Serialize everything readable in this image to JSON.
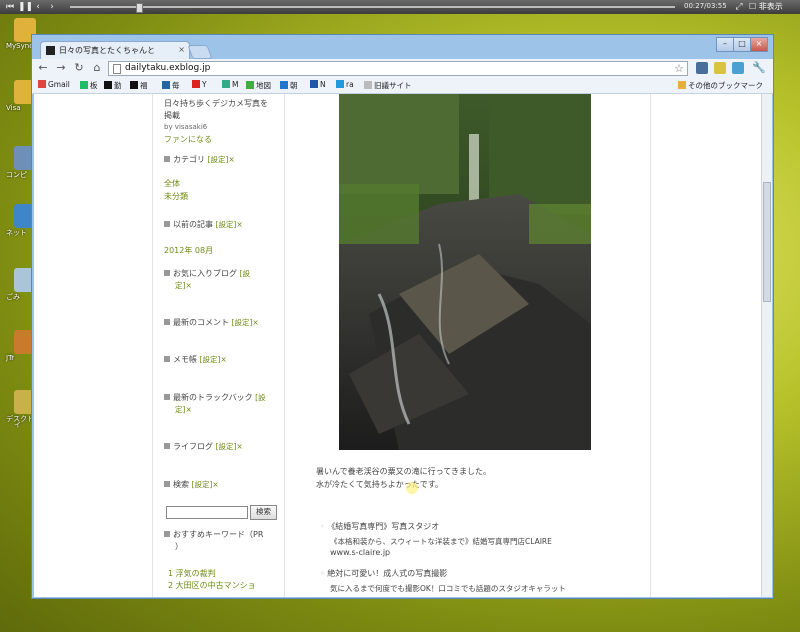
{
  "media_bar": {
    "time": "00:27/03:55",
    "toggle_label": "非表示"
  },
  "desktop": {
    "icons": [
      {
        "label": "MySync",
        "color": "#e0b23c"
      },
      {
        "label": "Visa",
        "color": "#e0b23c"
      },
      {
        "label": "コンピ",
        "color": "#6d8fb8"
      },
      {
        "label": "ネット",
        "color": "#3f86c8"
      },
      {
        "label": "ごみ",
        "color": "#aac4d8"
      },
      {
        "label": "JTr",
        "color": "#c87b2c"
      },
      {
        "label": "デスクト",
        "color": "#c9b04a"
      },
      {
        "label": "イ",
        "color": "#c9b04a"
      }
    ]
  },
  "browser": {
    "tab_title": "日々の写真とたくちゃんと",
    "url": "dailytaku.exblog.jp",
    "bookmarks": [
      {
        "label": "Gmail",
        "color": "#d44"
      },
      {
        "label": "板",
        "color": "#2b6"
      },
      {
        "label": "勤",
        "color": "#111"
      },
      {
        "label": "福",
        "color": "#111"
      },
      {
        "label": "毎",
        "color": "#26a"
      },
      {
        "label": "Y",
        "color": "#d22"
      },
      {
        "label": "M",
        "color": "#3a8"
      },
      {
        "label": "地図",
        "color": "#4a4"
      },
      {
        "label": "朝",
        "color": "#27c"
      },
      {
        "label": "N",
        "color": "#25a"
      },
      {
        "label": "ra",
        "color": "#29d"
      },
      {
        "label": "旧議サイト",
        "color": "#bbb"
      }
    ],
    "other_bookmarks": "その他のブックマーク"
  },
  "sidebar": {
    "profile_line1": "日々持ち歩くデジカメ写真を",
    "profile_line2": "掲載",
    "by_line": "by visasaki6",
    "fan_link": "ファンになる",
    "setting_label": "[設定]",
    "remove_label": "×",
    "categories_heading": "カテゴリ",
    "categories": [
      "全体",
      "未分類"
    ],
    "archive_heading": "以前の記事",
    "archive_items": [
      "2012年 08月"
    ],
    "favorites_heading_1": "お気に入りブログ",
    "favorites_cfg_1": "[設",
    "favorites_cfg_2": "定]",
    "recent_comments_heading": "最新のコメント",
    "memo_heading": "メモ帳",
    "trackback_heading": "最新のトラックバック",
    "trackback_cfg_1": "[設",
    "trackback_cfg_2": "定]",
    "lifelog_heading": "ライフログ",
    "search_heading": "検索",
    "search_button": "検索",
    "keywords_heading_1": "おすすめキーワード（PR",
    "keywords_heading_2": "）",
    "keywords": [
      "1 浮気の裁判",
      "2 大田区の中古マンショ"
    ]
  },
  "post": {
    "text_line1": "暑いんで養老渓谷の粟又の滝に行ってきました。",
    "text_line2": "水が冷たくて気持ちよかったです。",
    "ads": [
      {
        "title": "《結婚写真専門》写真スタジオ",
        "desc": "《本格和装から、スウィートな洋装まで》結婚写真専門店CLAIRE",
        "url": "www.s-claire.jp"
      },
      {
        "title": "絶対に可愛い！成人式の写真撮影",
        "desc": "気に入るまで何度でも撮影OK！口コミでも話題のスタジオキャラット",
        "url": ""
      }
    ]
  }
}
